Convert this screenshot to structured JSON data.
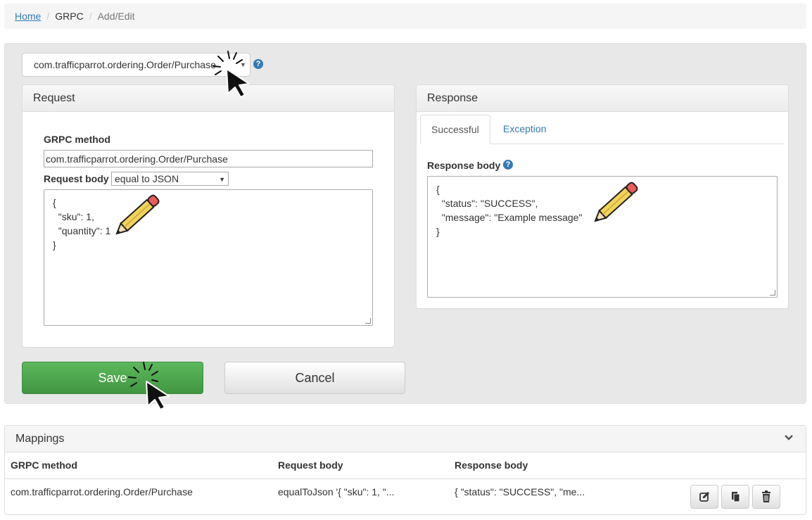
{
  "breadcrumb": {
    "home": "Home",
    "section": "GRPC",
    "current": "Add/Edit",
    "separator": "/"
  },
  "endpoint": {
    "selected": "com.trafficparrot.ordering.Order/Purchase",
    "help": "?"
  },
  "request": {
    "title": "Request",
    "grpc_method_label": "GRPC method",
    "grpc_method_value": "com.trafficparrot.ordering.Order/Purchase",
    "body_label": "Request body",
    "body_matcher": "equal to JSON",
    "body": "{\n  \"sku\": 1,\n  \"quantity\": 1\n}"
  },
  "response": {
    "title": "Response",
    "tabs": [
      "Successful",
      "Exception"
    ],
    "body_label": "Response body",
    "help": "?",
    "body": "{\n  \"status\": \"SUCCESS\",\n  \"message\": \"Example message\"\n}"
  },
  "actions": {
    "save": "Save",
    "cancel": "Cancel"
  },
  "mappings": {
    "title": "Mappings",
    "columns": [
      "GRPC method",
      "Request body",
      "Response body"
    ],
    "rows": [
      {
        "method": "com.trafficparrot.ordering.Order/Purchase",
        "request": "equalToJson '{ \"sku\": 1, \"...",
        "response": "{ \"status\": \"SUCCESS\", \"me..."
      }
    ]
  },
  "colors": {
    "link": "#337ab7",
    "save": "#4cae4c",
    "pencil": "#f2d35a",
    "eraser": "#ee5a5a"
  },
  "icons": [
    "cursor-icon",
    "click-burst-icon",
    "pencil-icon",
    "edit-icon",
    "copy-icon",
    "trash-icon",
    "chevron-down-icon",
    "question-icon"
  ]
}
